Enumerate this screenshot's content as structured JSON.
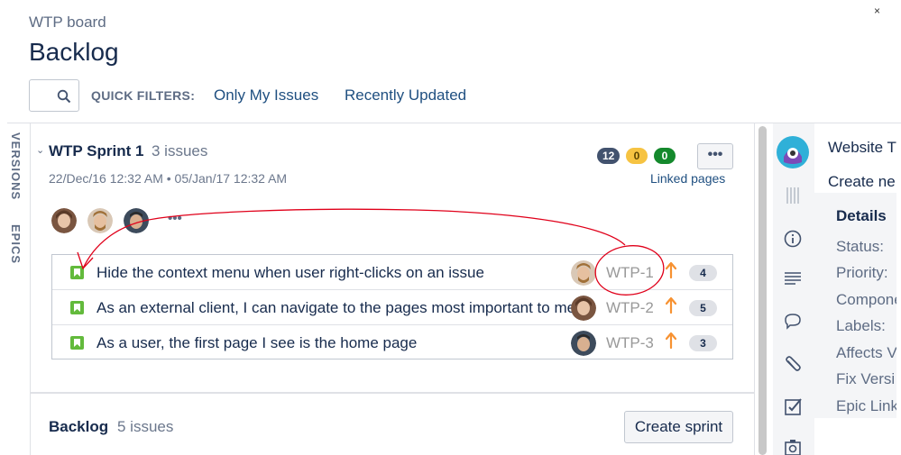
{
  "header": {
    "board_name": "WTP board",
    "page_title": "Backlog",
    "close_label": "×"
  },
  "quick_filters": {
    "label": "QUICK FILTERS:",
    "filters": [
      "Only My Issues",
      "Recently Updated"
    ]
  },
  "side_tabs": [
    "VERSIONS",
    "EPICS"
  ],
  "sprint": {
    "name": "WTP Sprint 1",
    "count": "3 issues",
    "dates": "22/Dec/16 12:32 AM • 05/Jan/17 12:32 AM",
    "badges": [
      {
        "value": "12",
        "color": "#42526e",
        "text_color": "#ffffff"
      },
      {
        "value": "0",
        "color": "#f6c342",
        "text_color": "#594300"
      },
      {
        "value": "0",
        "color": "#14892c",
        "text_color": "#ffffff"
      }
    ],
    "more_label": "•••",
    "linked_pages": "Linked pages",
    "assignee_more": "•••",
    "issues": [
      {
        "type_icon": "story-icon",
        "summary": "Hide the context menu when user right-clicks on an issue",
        "key": "WTP-1",
        "priority_icon": "arrow-up-icon",
        "estimate": "4"
      },
      {
        "type_icon": "story-icon",
        "summary": "As an external client, I can navigate to the pages most important to me",
        "key": "WTP-2",
        "priority_icon": "arrow-up-icon",
        "estimate": "5"
      },
      {
        "type_icon": "story-icon",
        "summary": "As a user, the first page I see is the home page",
        "key": "WTP-3",
        "priority_icon": "arrow-up-icon",
        "estimate": "3"
      }
    ]
  },
  "backlog": {
    "title": "Backlog",
    "count": "5 issues",
    "create_sprint": "Create sprint"
  },
  "right_panel": {
    "project_title": "Website T",
    "create_text": "Create ne",
    "details_heading": "Details",
    "fields": [
      "Status:",
      "Priority:",
      "Compone",
      "Labels:",
      "Affects V",
      "Fix Versi",
      "Epic Link"
    ]
  },
  "colors": {
    "link": "#205081",
    "story": "#63ba3c",
    "priority": "#f79232",
    "annotation": "#e0001a"
  }
}
